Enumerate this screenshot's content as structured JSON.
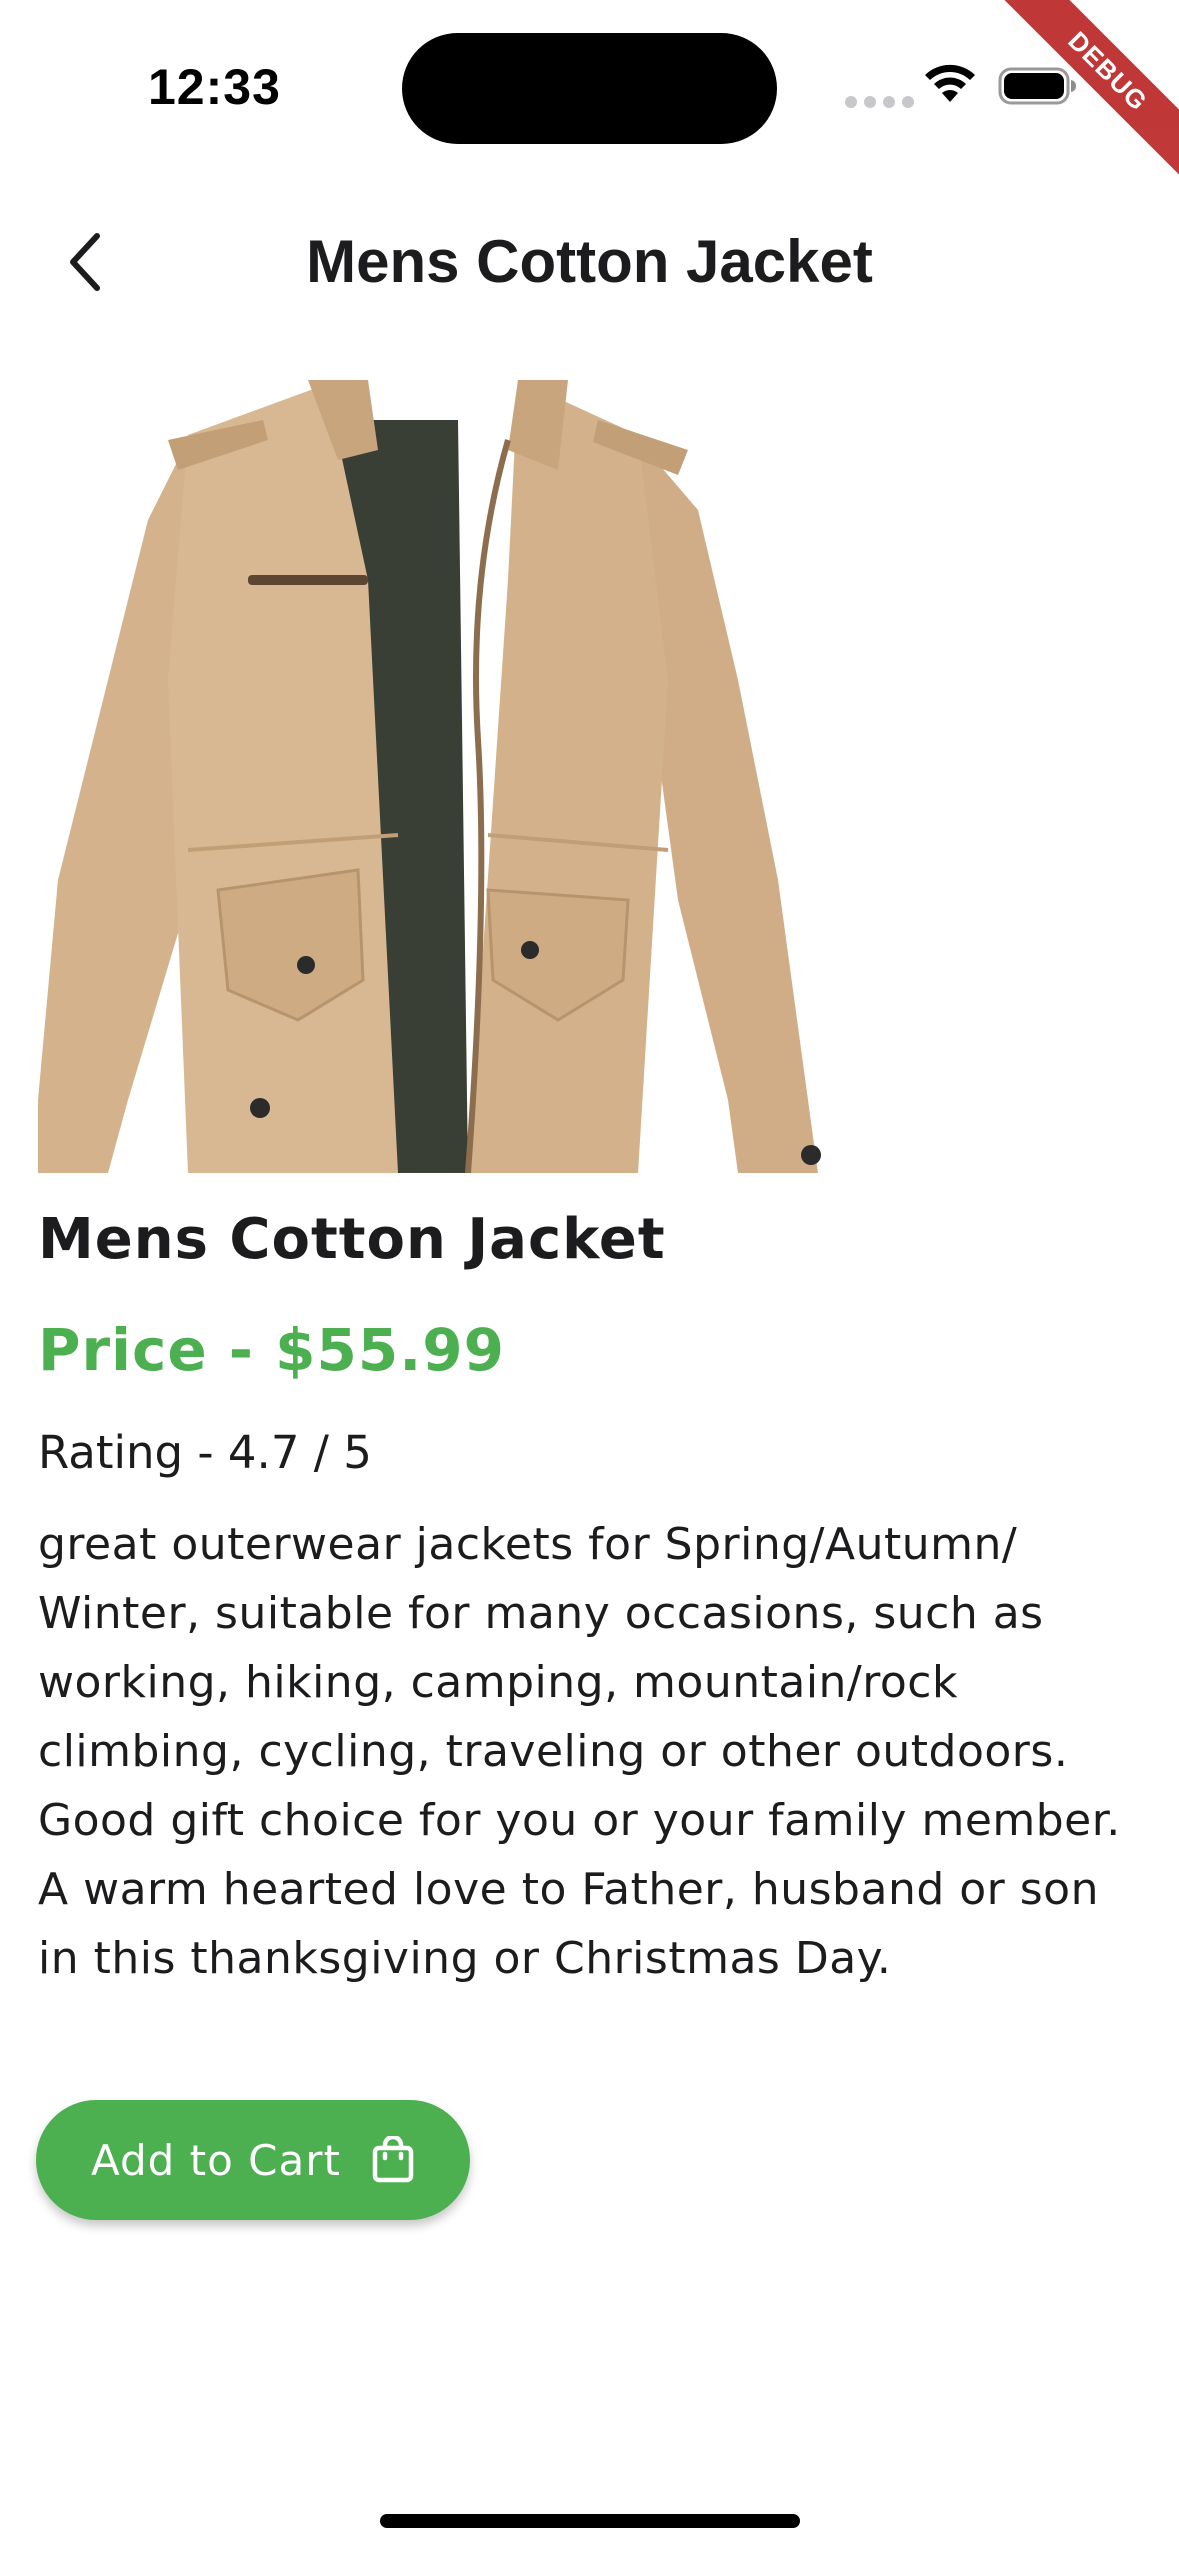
{
  "status_bar": {
    "time": "12:33"
  },
  "debug_banner": {
    "label": "DEBUG"
  },
  "app_bar": {
    "title": "Mens Cotton Jacket",
    "back_icon": "chevron-left-icon"
  },
  "product": {
    "image_description": "khaki-mens-cotton-jacket",
    "name": "Mens Cotton Jacket",
    "price_text": "Price - $55.99",
    "rating_text": "Rating - 4.7 / 5",
    "description": "great outerwear jackets for Spring/Autumn/ Winter, suitable for many occasions, such as working, hiking, camping, mountain/rock climbing, cycling, traveling or other outdoors. Good gift choice for you or your family member. A warm hearted love to Father, husband or son in this thanksgiving or Christmas Day."
  },
  "actions": {
    "add_to_cart_label": "Add to Cart",
    "add_to_cart_icon": "shopping-bag-icon"
  },
  "colors": {
    "accent_green": "#4caf50",
    "text_primary": "#1c1c1e",
    "debug_red": "#b71c1c",
    "jacket_khaki": "#d2b08a"
  }
}
